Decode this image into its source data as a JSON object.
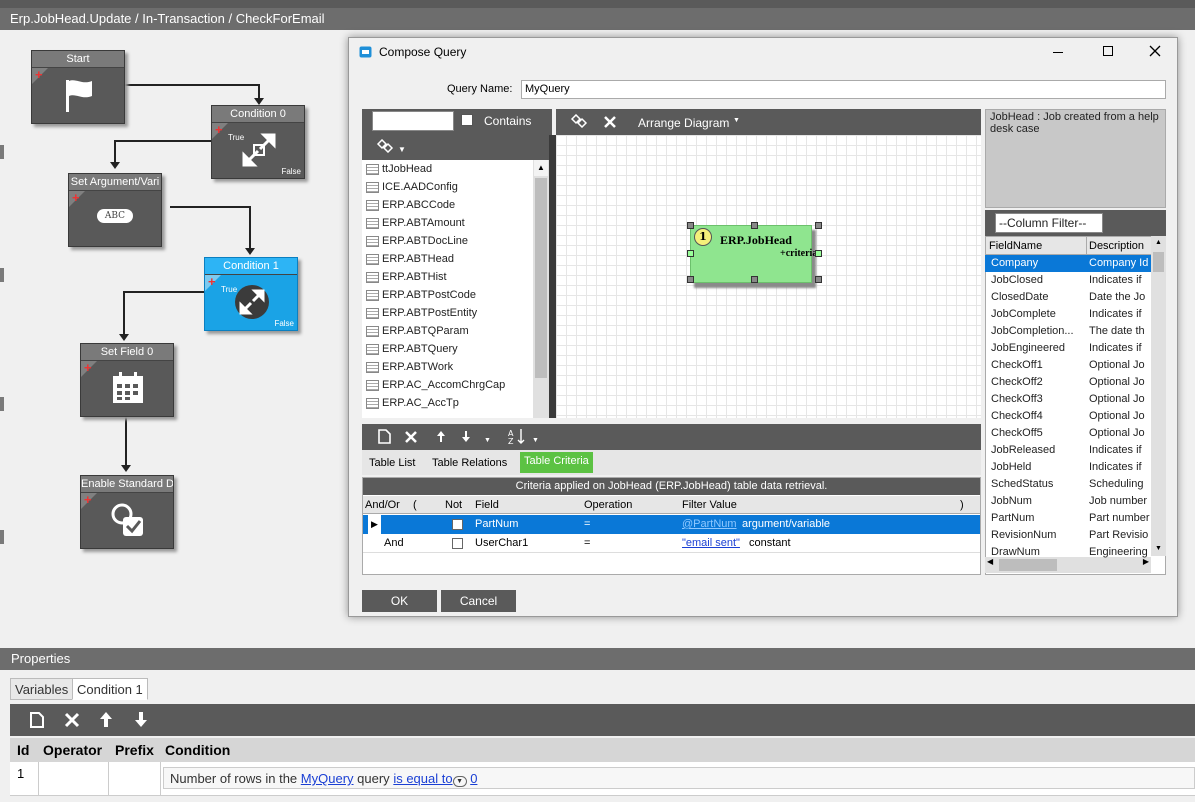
{
  "workflow": {
    "title": "Erp.JobHead.Update / In-Transaction / CheckForEmail",
    "nodes": {
      "start": "Start",
      "condition0": "Condition 0",
      "setarg": "Set Argument/Vari",
      "condition1": "Condition 1",
      "setfield": "Set Field 0",
      "enable": "Enable Standard D"
    },
    "true_label": "True",
    "false_label": "False",
    "abc": "ABC"
  },
  "properties": {
    "header": "Properties",
    "tabs": [
      "Variables",
      "Condition 1"
    ],
    "columns": [
      "Id",
      "Operator",
      "Prefix",
      "Condition"
    ],
    "row": {
      "id": "1",
      "text1": "Number of rows in the",
      "query": "MyQuery",
      "text2": "query",
      "op": "is equal to",
      "value": "0"
    }
  },
  "dialog": {
    "title": "Compose Query",
    "query_name_label": "Query Name:",
    "query_name": "MyQuery",
    "contains": "Contains",
    "arrange": "Arrange Diagram",
    "tables": [
      "ttJobHead",
      "ICE.AADConfig",
      "ERP.ABCCode",
      "ERP.ABTAmount",
      "ERP.ABTDocLine",
      "ERP.ABTHead",
      "ERP.ABTHist",
      "ERP.ABTPostCode",
      "ERP.ABTPostEntity",
      "ERP.ABTQParam",
      "ERP.ABTQuery",
      "ERP.ABTWork",
      "ERP.AC_AccomChrgCap",
      "ERP.AC_AccTp"
    ],
    "diagram_node": {
      "num": "1",
      "name": "ERP.JobHead",
      "criteria": "+criteria"
    },
    "description": "JobHead : Job created from a help desk case",
    "column_filter": "--Column Filter--",
    "field_cols": [
      "FieldName",
      "Description"
    ],
    "fields": [
      [
        "Company",
        "Company Id"
      ],
      [
        "JobClosed",
        "Indicates if"
      ],
      [
        "ClosedDate",
        "Date the Jo"
      ],
      [
        "JobComplete",
        "Indicates if"
      ],
      [
        "JobCompletion...",
        "The date th"
      ],
      [
        "JobEngineered",
        "Indicates if"
      ],
      [
        "CheckOff1",
        "Optional Jo"
      ],
      [
        "CheckOff2",
        "Optional Jo"
      ],
      [
        "CheckOff3",
        "Optional Jo"
      ],
      [
        "CheckOff4",
        "Optional Jo"
      ],
      [
        "CheckOff5",
        "Optional Jo"
      ],
      [
        "JobReleased",
        "Indicates if"
      ],
      [
        "JobHeld",
        "Indicates if"
      ],
      [
        "SchedStatus",
        "Scheduling"
      ],
      [
        "JobNum",
        "Job number"
      ],
      [
        "PartNum",
        "Part number"
      ],
      [
        "RevisionNum",
        "Part Revisio"
      ],
      [
        "DrawNum",
        "Engineering"
      ]
    ],
    "tabs": [
      "Table List",
      "Table Relations",
      "Table Criteria"
    ],
    "criteria_caption": "Criteria applied on JobHead (ERP.JobHead)  table data retrieval.",
    "criteria_cols": [
      "And/Or",
      "(",
      "Not",
      "Field",
      "Operation",
      "Filter Value",
      ")"
    ],
    "criteria_rows": [
      {
        "andor": "",
        "field": "PartNum",
        "op": "=",
        "value": "@PartNum",
        "type": "argument/variable"
      },
      {
        "andor": "And",
        "field": "UserChar1",
        "op": "=",
        "value": "\"email sent\"",
        "type": "constant"
      }
    ],
    "ok": "OK",
    "cancel": "Cancel"
  }
}
